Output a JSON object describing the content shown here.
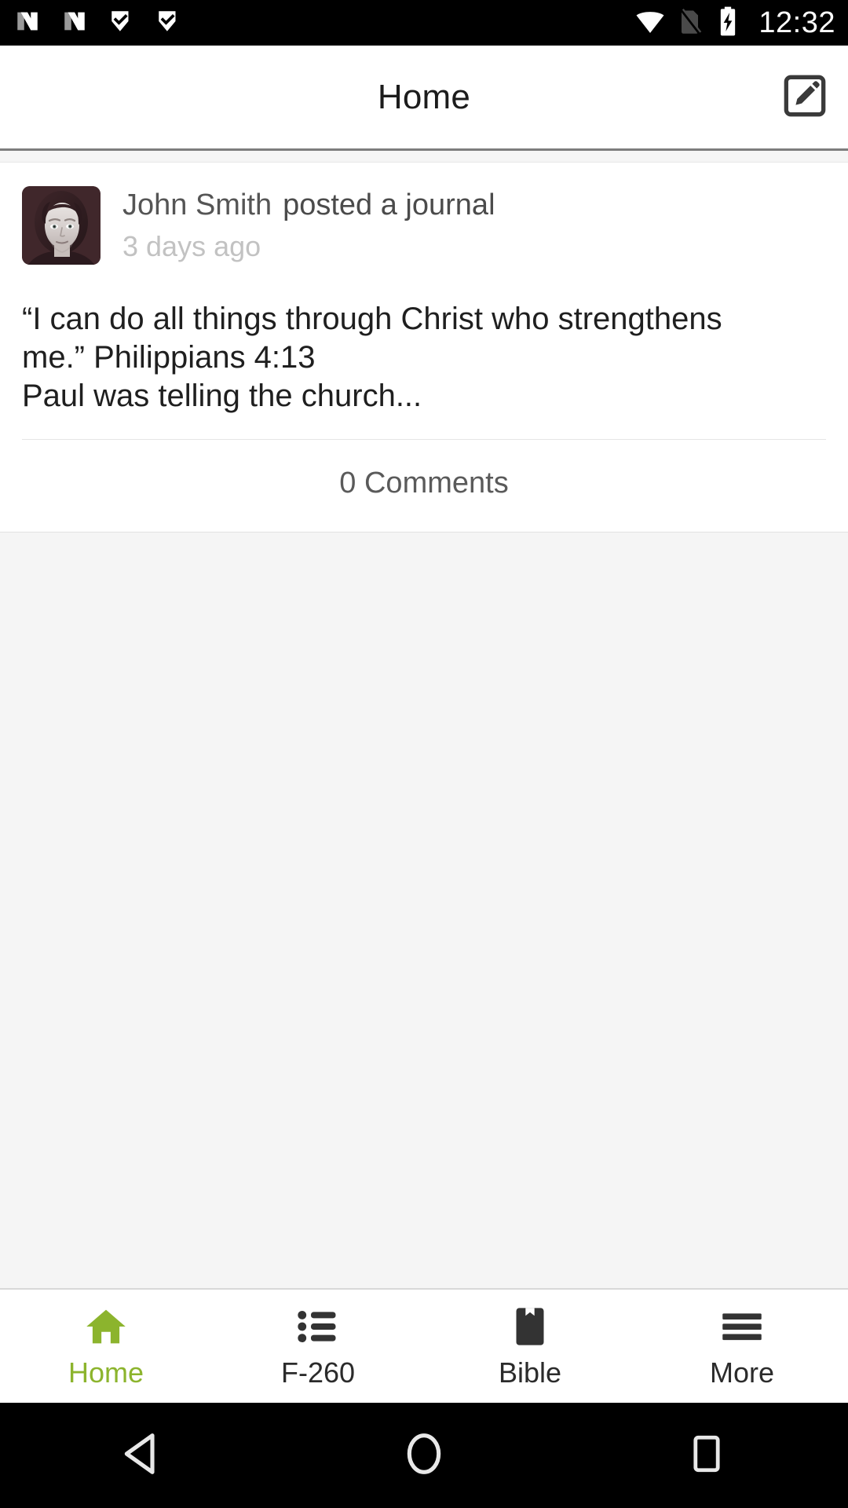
{
  "statusbar": {
    "time": "12:32",
    "left_icons": [
      {
        "name": "notification-n-icon-1",
        "label": "N"
      },
      {
        "name": "notification-n-icon-2",
        "label": "N"
      },
      {
        "name": "notification-check-icon-1",
        "label": "check"
      },
      {
        "name": "notification-check-icon-2",
        "label": "check"
      }
    ],
    "right_icons": [
      {
        "name": "wifi-icon",
        "label": "wifi"
      },
      {
        "name": "sim-off-icon",
        "label": "no sim"
      },
      {
        "name": "battery-charging-icon",
        "label": "battery charging"
      }
    ]
  },
  "header": {
    "title": "Home",
    "action_icon": "compose-edit-icon"
  },
  "feed": {
    "posts": [
      {
        "author": "John Smith",
        "action": "posted a journal",
        "timestamp": "3 days ago",
        "body_lines": [
          "“I can do all things through Christ who strengthens",
          "me.” Philippians 4:13",
          "Paul was telling the church..."
        ],
        "comments_label": "0 Comments",
        "avatar_name": "user-avatar-photo"
      }
    ]
  },
  "tabbar": {
    "active_color": "#8cb42d",
    "items": [
      {
        "label": "Home",
        "icon": "home-icon",
        "active": true
      },
      {
        "label": "F-260",
        "icon": "list-icon",
        "active": false
      },
      {
        "label": "Bible",
        "icon": "bookmark-icon",
        "active": false
      },
      {
        "label": "More",
        "icon": "hamburger-icon",
        "active": false
      }
    ]
  },
  "navbar": {
    "items": [
      {
        "name": "android-back-button",
        "icon": "triangle-back-icon"
      },
      {
        "name": "android-home-button",
        "icon": "circle-home-icon"
      },
      {
        "name": "android-recents-button",
        "icon": "square-recents-icon"
      }
    ]
  }
}
